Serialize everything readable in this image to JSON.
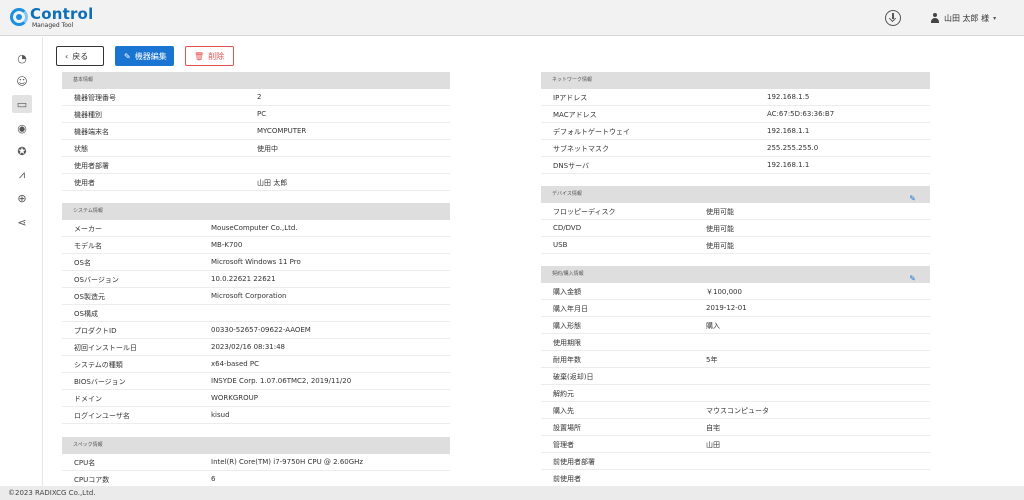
{
  "header": {
    "app_title": "Control",
    "app_subtitle": "Managed Tool",
    "user_name": "山田 太郎 様",
    "caret": "▾"
  },
  "sidebar": {
    "items": [
      {
        "name": "dashboard",
        "icon": "speedometer-icon",
        "glyph": "◔"
      },
      {
        "name": "users",
        "icon": "users-group-icon",
        "glyph": "☺"
      },
      {
        "name": "devices",
        "icon": "laptop-icon",
        "glyph": "▭"
      },
      {
        "name": "disc",
        "icon": "disc-icon",
        "glyph": "◉"
      },
      {
        "name": "award",
        "icon": "badge-icon",
        "glyph": "✪"
      },
      {
        "name": "reports",
        "icon": "chart-icon",
        "glyph": "⩘"
      },
      {
        "name": "network",
        "icon": "globe-network-icon",
        "glyph": "⊕"
      },
      {
        "name": "share",
        "icon": "share-icon",
        "glyph": "⋖"
      }
    ]
  },
  "toolbar": {
    "back_label": "戻る",
    "back_glyph": "‹",
    "edit_label": "機器編集",
    "edit_glyph": "✎",
    "delete_label": "削除",
    "delete_glyph": "🗑"
  },
  "sections": {
    "basic": {
      "title": "基本情報",
      "rows": [
        {
          "label": "機器管理番号",
          "value": "2"
        },
        {
          "label": "機器種別",
          "value": "PC"
        },
        {
          "label": "機器端末名",
          "value": "MYCOMPUTER"
        },
        {
          "label": "状態",
          "value": "使用中"
        },
        {
          "label": "使用者部署",
          "value": ""
        },
        {
          "label": "使用者",
          "value": "山田 太郎"
        }
      ]
    },
    "system": {
      "title": "システム情報",
      "rows": [
        {
          "label": "メーカー",
          "value": "MouseComputer Co.,Ltd."
        },
        {
          "label": "モデル名",
          "value": "MB-K700"
        },
        {
          "label": "OS名",
          "value": "Microsoft Windows 11 Pro"
        },
        {
          "label": "OSバージョン",
          "value": "10.0.22621 22621"
        },
        {
          "label": "OS製造元",
          "value": "Microsoft Corporation"
        },
        {
          "label": "OS構成",
          "value": ""
        },
        {
          "label": "プロダクトID",
          "value": "00330-52657-09622-AAOEM"
        },
        {
          "label": "初回インストール日",
          "value": "2023/02/16 08:31:48"
        },
        {
          "label": "システムの種類",
          "value": "x64-based PC"
        },
        {
          "label": "BIOSバージョン",
          "value": "INSYDE Corp. 1.07.06TMC2, 2019/11/20"
        },
        {
          "label": "ドメイン",
          "value": "WORKGROUP"
        },
        {
          "label": "ログインユーザ名",
          "value": "kisud"
        }
      ]
    },
    "spec": {
      "title": "スペック情報",
      "rows": [
        {
          "label": "CPU名",
          "value": "Intel(R) Core(TM) i7-9750H CPU @ 2.60GHz"
        },
        {
          "label": "CPUコア数",
          "value": "6"
        }
      ]
    },
    "network": {
      "title": "ネットワーク情報",
      "rows": [
        {
          "label": "IPアドレス",
          "value": "192.168.1.5"
        },
        {
          "label": "MACアドレス",
          "value": "AC:67:5D:63:36:B7"
        },
        {
          "label": "デフォルトゲートウェイ",
          "value": "192.168.1.1"
        },
        {
          "label": "サブネットマスク",
          "value": "255.255.255.0"
        },
        {
          "label": "DNSサーバ",
          "value": "192.168.1.1"
        }
      ]
    },
    "device": {
      "title": "デバイス情報",
      "rows": [
        {
          "label": "フロッピーディスク",
          "value": "使用可能"
        },
        {
          "label": "CD/DVD",
          "value": "使用可能"
        },
        {
          "label": "USB",
          "value": "使用可能"
        }
      ]
    },
    "contract": {
      "title": "契約/購入情報",
      "rows": [
        {
          "label": "購入金額",
          "value": "￥100,000"
        },
        {
          "label": "購入年月日",
          "value": "2019-12-01"
        },
        {
          "label": "購入形態",
          "value": "購入"
        },
        {
          "label": "使用期限",
          "value": ""
        },
        {
          "label": "耐用年数",
          "value": "5年"
        },
        {
          "label": "破棄(返却)日",
          "value": ""
        },
        {
          "label": "解約元",
          "value": ""
        },
        {
          "label": "購入先",
          "value": "マウスコンピュータ"
        },
        {
          "label": "設置場所",
          "value": "自宅"
        },
        {
          "label": "管理者",
          "value": "山田"
        },
        {
          "label": "前使用者部署",
          "value": ""
        },
        {
          "label": "前使用者",
          "value": ""
        }
      ]
    }
  },
  "footer": {
    "copyright": "©2023 RADIXCG Co.,Ltd."
  }
}
